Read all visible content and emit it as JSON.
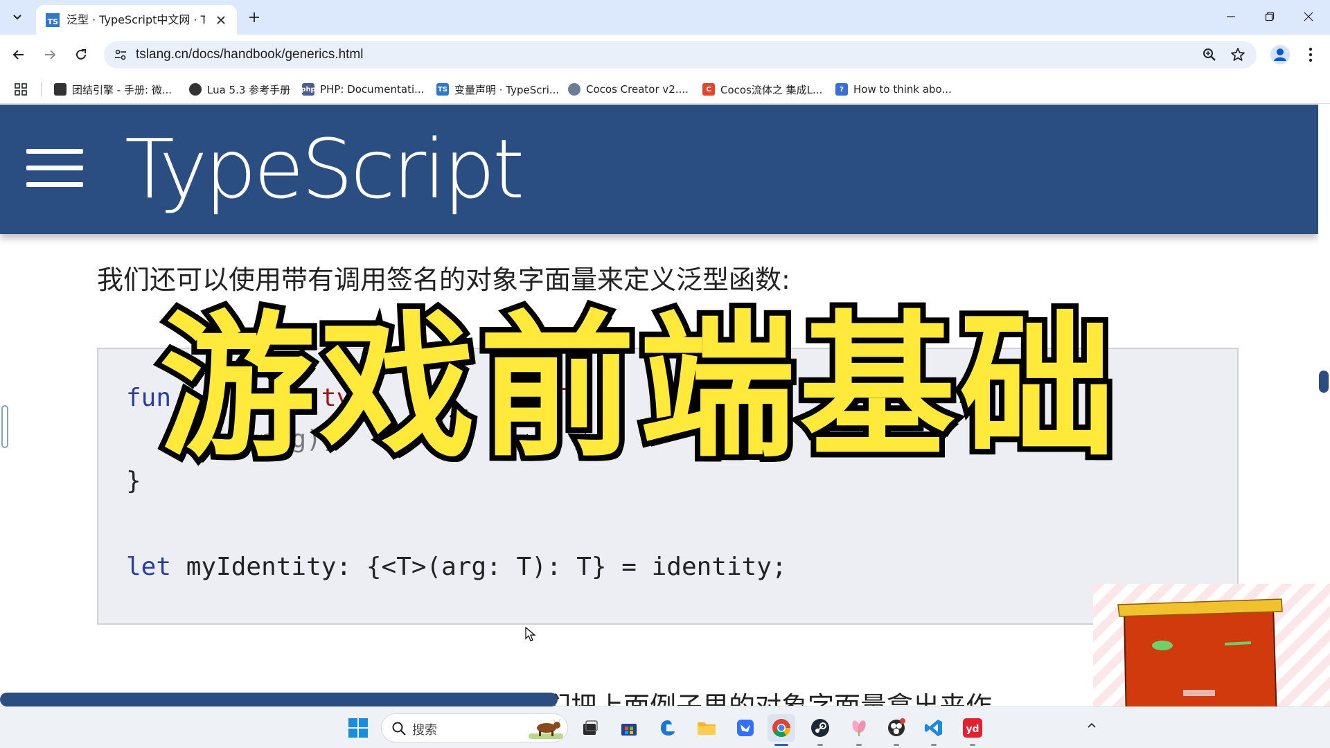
{
  "browser": {
    "tab": {
      "title": "泛型 · TypeScript中文网 · Type",
      "favicon_text": "TS"
    },
    "url": "tslang.cn/docs/handbook/generics.html",
    "bookmarks": [
      {
        "label": "团结引擎 - 手册: 微...",
        "icon_color": "#333333"
      },
      {
        "label": "Lua 5.3 参考手册",
        "icon_color": "#333333"
      },
      {
        "label": "PHP: Documentati...",
        "icon_color": "#4f5b93",
        "icon_text": "php"
      },
      {
        "label": "变量声明 · TypeScri...",
        "icon_color": "#3178c6",
        "icon_text": "TS"
      },
      {
        "label": "Cocos Creator v2....",
        "icon_color": "#6a7d99"
      },
      {
        "label": "Cocos流体之 集成L...",
        "icon_color": "#e3462b",
        "icon_text": "C"
      },
      {
        "label": "How to think abo...",
        "icon_color": "#3b6fd4",
        "icon_text": "?"
      }
    ]
  },
  "page": {
    "brand": "TypeScript",
    "intro": "我们还可以使用带有调用签名的对象字面量来定义泛型函数:",
    "code": {
      "line1_kw": "fun",
      "line1_rest": "     er   ty    (a        T",
      "line2": "    r n  a g);",
      "line3": "}",
      "line5_kw": "let",
      "line5_rest": " myIdentity: {<T>(arg: T): T} = identity;"
    },
    "bottom_text": "这引导我们去写第一个泛型接口了。我们把上面例子里的对象字面量拿出来作"
  },
  "overlay": {
    "title": "游戏前端基础"
  },
  "taskbar": {
    "search_placeholder": "搜索"
  },
  "colors": {
    "header_bg": "#2b4e82",
    "overlay_fill": "#ffe93a",
    "tab_strip": "#dce8fb"
  }
}
